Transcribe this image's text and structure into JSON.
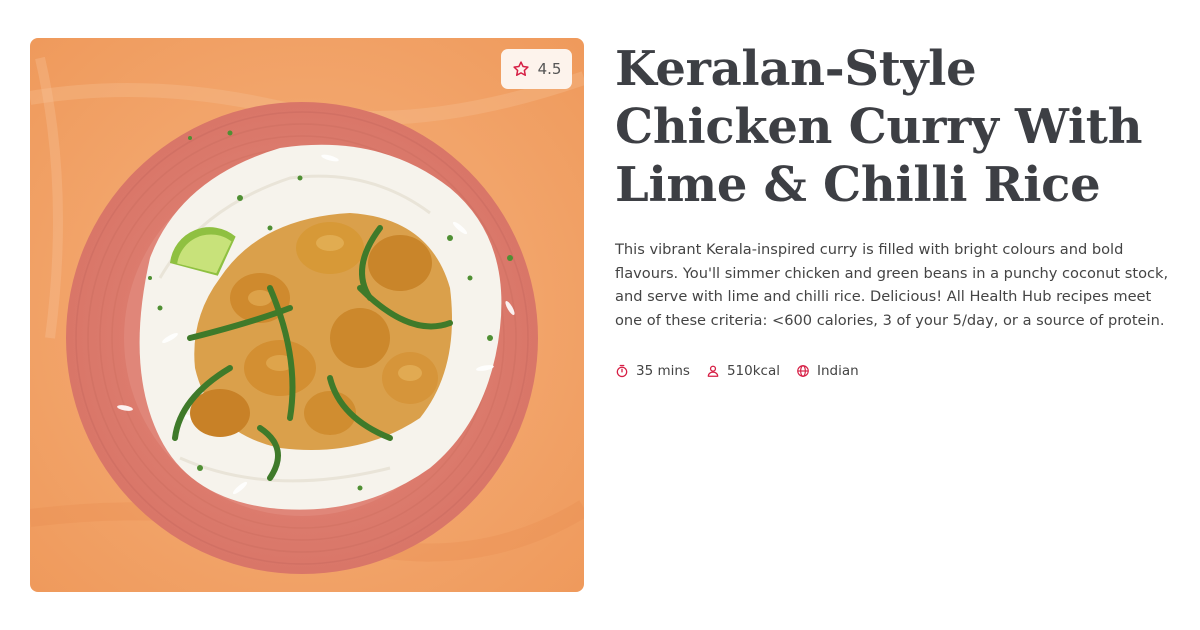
{
  "recipe": {
    "title": "Keralan-Style Chicken Curry With Lime & Chilli Rice",
    "description": "This vibrant Kerala-inspired curry is filled with bright colours and bold flavours. You'll simmer chicken and green beans in a punchy coconut stock, and serve with lime and chilli rice. Delicious! All Health Hub recipes meet one of these criteria: <600 calories, 3 of your 5/day, or a source of protein.",
    "rating": "4.5",
    "meta": {
      "time": "35 mins",
      "calories": "510kcal",
      "cuisine": "Indian"
    },
    "icons": {
      "rating": "star-icon",
      "time": "stopwatch-icon",
      "calories": "person-icon",
      "cuisine": "globe-icon"
    }
  },
  "colors": {
    "accent": "#d61f45",
    "title": "#3d3f44",
    "badge_background": "#fdf3ec",
    "image_background": "#f2a46a",
    "plate": "#e08477"
  }
}
